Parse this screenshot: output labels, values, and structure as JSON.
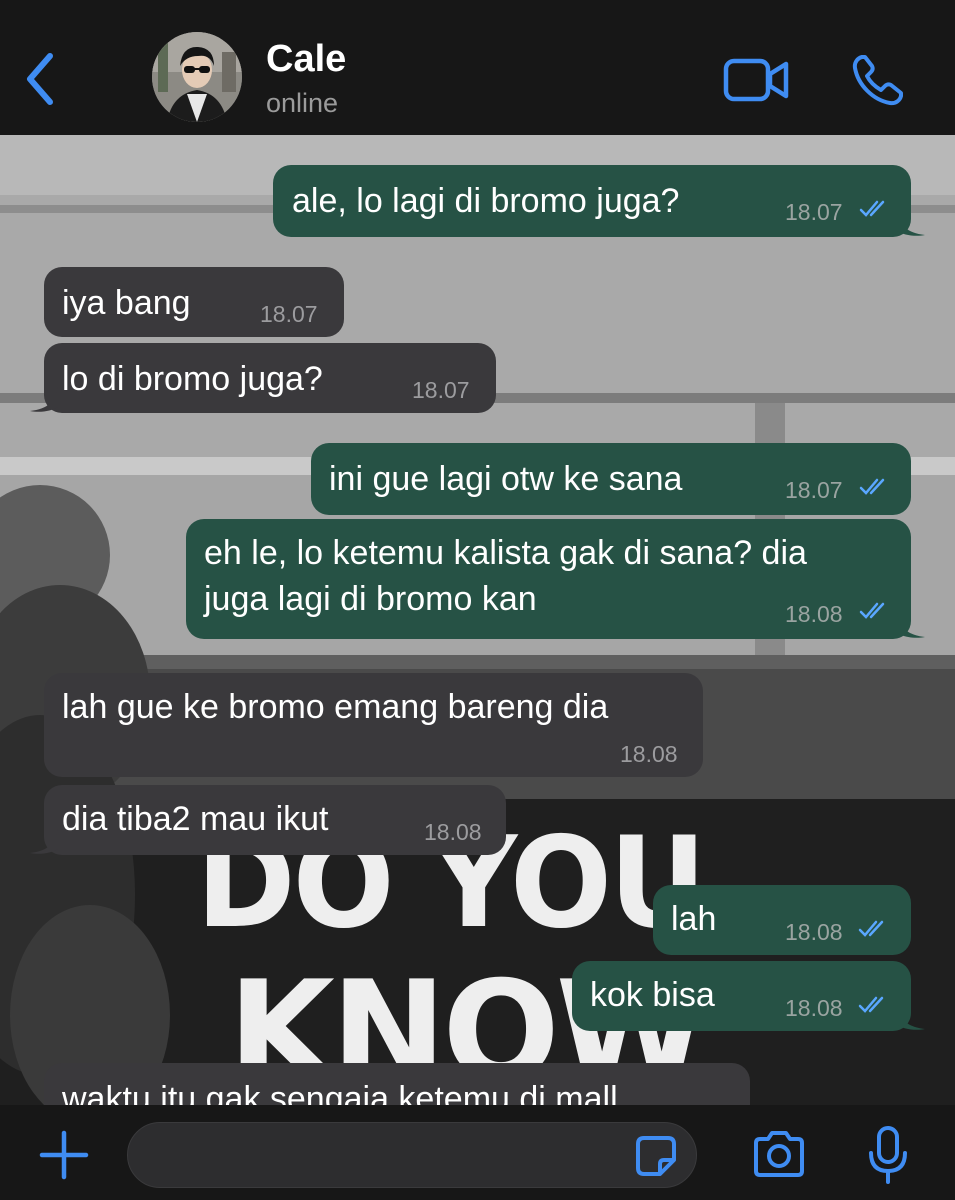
{
  "header": {
    "contact_name": "Cale",
    "status": "online"
  },
  "colors": {
    "accent": "#3f8cf2",
    "outgoing_bubble": "#265245",
    "incoming_bubble": "#3a393c",
    "bar_background": "#171717"
  },
  "icons": [
    "back-chevron-icon",
    "video-call-icon",
    "phone-icon",
    "plus-icon",
    "sticker-icon",
    "camera-icon",
    "microphone-icon",
    "double-check-icon"
  ],
  "wallpaper": {
    "text_line1": "DO YOU",
    "text_line2": "KNOW"
  },
  "messages": [
    {
      "direction": "outgoing",
      "lines": [
        "ale, lo lagi di bromo juga?"
      ],
      "time": "18.07",
      "read": true
    },
    {
      "direction": "incoming",
      "lines": [
        "iya bang"
      ],
      "time": "18.07"
    },
    {
      "direction": "incoming",
      "lines": [
        "lo di bromo juga?"
      ],
      "time": "18.07"
    },
    {
      "direction": "outgoing",
      "lines": [
        "ini gue lagi otw ke sana"
      ],
      "time": "18.07",
      "read": true
    },
    {
      "direction": "outgoing",
      "lines": [
        "eh le, lo ketemu kalista gak di sana? dia",
        "juga lagi di bromo kan"
      ],
      "time": "18.08",
      "read": true
    },
    {
      "direction": "incoming",
      "lines": [
        "lah gue ke bromo emang bareng dia"
      ],
      "time": "18.08"
    },
    {
      "direction": "incoming",
      "lines": [
        "dia tiba2 mau ikut"
      ],
      "time": "18.08"
    },
    {
      "direction": "outgoing",
      "lines": [
        "lah"
      ],
      "time": "18.08",
      "read": true
    },
    {
      "direction": "outgoing",
      "lines": [
        "kok bisa"
      ],
      "time": "18.08",
      "read": true
    },
    {
      "direction": "incoming",
      "lines": [
        "waktu itu gak sengaja ketemu di mall"
      ],
      "time": ""
    }
  ],
  "composer": {
    "value": "",
    "placeholder": ""
  }
}
